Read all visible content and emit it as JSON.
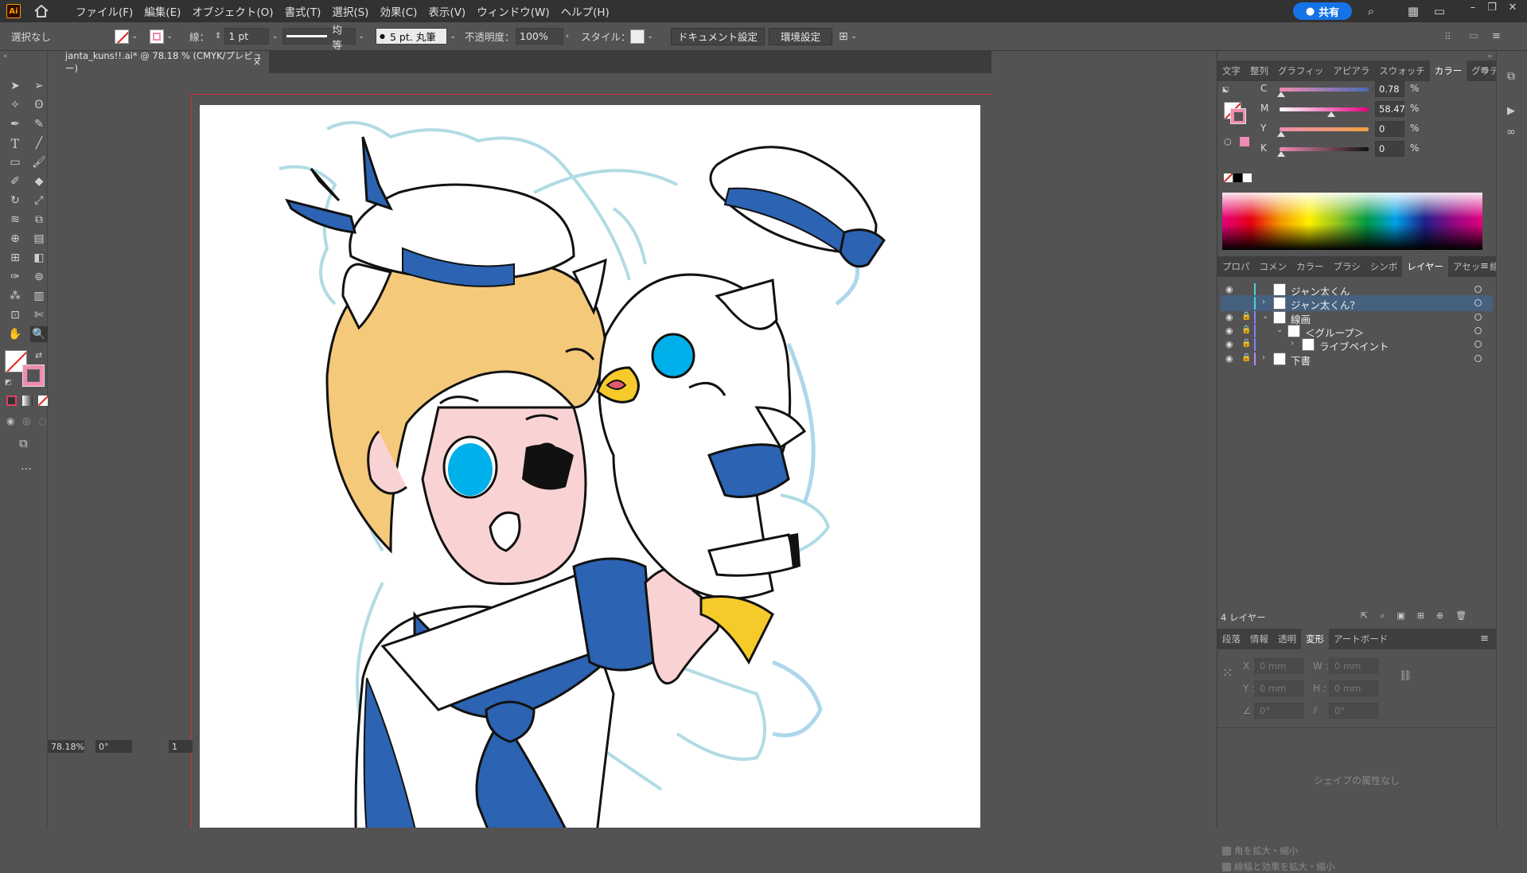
{
  "app": {
    "logo": "Ai",
    "menus": [
      "ファイル(F)",
      "編集(E)",
      "オブジェクト(O)",
      "書式(T)",
      "選択(S)",
      "効果(C)",
      "表示(V)",
      "ウィンドウ(W)",
      "ヘルプ(H)"
    ],
    "share_label": "共有"
  },
  "controlbar": {
    "selection": "選択なし",
    "stroke_label": "線：",
    "stroke_weight": "1 pt",
    "stroke_profile": "均等",
    "brush": "5 pt. 丸筆",
    "opacity_label": "不透明度：",
    "opacity_value": "100%",
    "style_label": "スタイル：",
    "doc_settings": "ドキュメント設定",
    "preferences": "環境設定"
  },
  "document": {
    "tab_title": "janta_kuns!!.ai* @ 78.18 % (CMYK/プレビュー)",
    "zoom": "78.18%",
    "rotation": "0°",
    "artboard_number": "1"
  },
  "color_panel": {
    "tabs": [
      "文字",
      "整列",
      "グラフィッ",
      "アピアラ",
      "スウォッチ",
      "カラー",
      "グラデー"
    ],
    "active_tab": "カラー",
    "channels": [
      {
        "label": "C",
        "value": "0.78",
        "pct": "%"
      },
      {
        "label": "M",
        "value": "58.47",
        "pct": "%"
      },
      {
        "label": "Y",
        "value": "0",
        "pct": "%"
      },
      {
        "label": "K",
        "value": "0",
        "pct": "%"
      }
    ],
    "fill_color": "#f08bb4"
  },
  "layers_panel": {
    "tabs": [
      "プロパ",
      "コメン",
      "カラー",
      "ブラシ",
      "シンボ",
      "レイヤー",
      "アセッ",
      "線"
    ],
    "active_tab": "レイヤー",
    "layers": [
      {
        "name": "ジャン太くん",
        "visible": true,
        "locked": false,
        "indent": 0,
        "expand": "",
        "color": "#4fd2d2"
      },
      {
        "name": "ジャン太くん？",
        "visible": false,
        "locked": false,
        "indent": 0,
        "expand": "›",
        "color": "#4fd2d2",
        "selected": true
      },
      {
        "name": "線画",
        "visible": true,
        "locked": true,
        "indent": 0,
        "expand": "⌄",
        "color": "#8080ff"
      },
      {
        "name": "＜グループ＞",
        "visible": true,
        "locked": false,
        "indent": 1,
        "expand": "⌄",
        "color": "#8080ff"
      },
      {
        "name": "ライブペイント",
        "visible": true,
        "locked": false,
        "indent": 2,
        "expand": "›",
        "color": "#8080ff"
      },
      {
        "name": "下書",
        "visible": true,
        "locked": true,
        "indent": 0,
        "expand": "›",
        "color": "#c080ff"
      }
    ],
    "count_label": "4 レイヤー"
  },
  "transform_panel": {
    "tabs": [
      "段落",
      "情報",
      "透明",
      "変形",
      "アートボード"
    ],
    "active_tab": "変形",
    "x": "0 mm",
    "y": "0 mm",
    "w": "0 mm",
    "h": "0 mm",
    "angle": "0°",
    "shear": "0°",
    "no_shape": "シェイプの属性なし",
    "opt1": "角を拡大・縮小",
    "opt2": "線幅と効果を拡大・縮小"
  }
}
